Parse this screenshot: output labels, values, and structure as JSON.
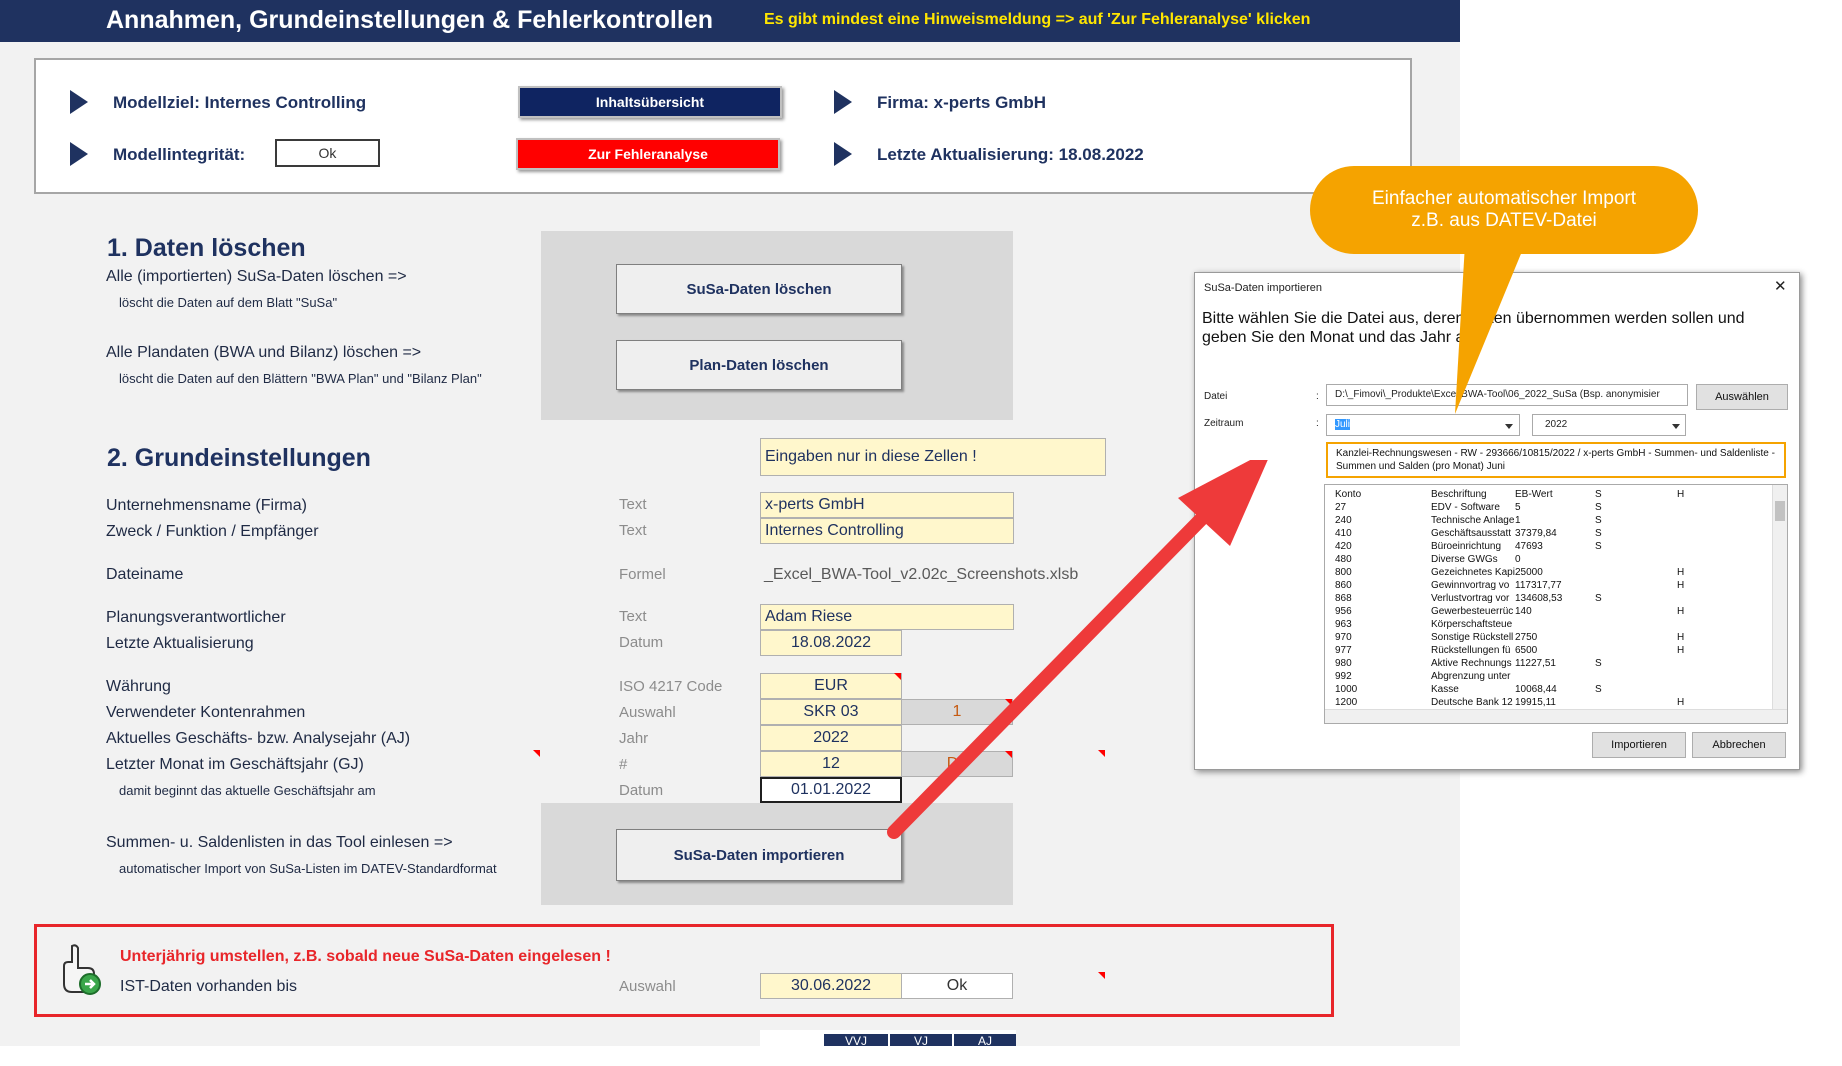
{
  "header": {
    "title": "Annahmen, Grundeinstellungen & Fehlerkontrollen",
    "hint": "Es gibt mindest eine Hinweismeldung => auf 'Zur Fehleranalyse' klicken"
  },
  "topbox": {
    "modellziel": "Modellziel: Internes Controlling",
    "modellintegritaet": "Modellintegrität:",
    "integritaet_value": "Ok",
    "btn_inhalt": "Inhaltsübersicht",
    "btn_fehler": "Zur Fehleranalyse",
    "firma": "Firma: x-perts GmbH",
    "aktualisierung": "Letzte Aktualisierung: 18.08.2022"
  },
  "section1": {
    "heading": "1. Daten löschen",
    "row1": "Alle (importierten) SuSa-Daten löschen =>",
    "row1_sub": "löscht die Daten auf dem Blatt \"SuSa\"",
    "row2": "Alle Plandaten (BWA und Bilanz) löschen =>",
    "row2_sub": "löscht die Daten auf den Blättern \"BWA Plan\" und \"Bilanz Plan\"",
    "btn_susa": "SuSa-Daten löschen",
    "btn_plan": "Plan-Daten löschen"
  },
  "section2": {
    "heading": "2. Grundeinstellungen",
    "input_hint": "Eingaben nur in diese Zellen !",
    "rows": {
      "firma_label": "Unternehmensname (Firma)",
      "firma_type": "Text",
      "firma_value": "x-perts GmbH",
      "zweck_label": "Zweck / Funktion / Empfänger",
      "zweck_type": "Text",
      "zweck_value": "Internes Controlling",
      "datei_label": "Dateiname",
      "datei_type": "Formel",
      "datei_value": "_Excel_BWA-Tool_v2.02c_Screenshots.xlsb",
      "plan_label": "Planungsverantwortlicher",
      "plan_type": "Text",
      "plan_value": "Adam Riese",
      "akt_label": "Letzte Aktualisierung",
      "akt_type": "Datum",
      "akt_value": "18.08.2022",
      "wae_label": "Währung",
      "wae_type": "ISO 4217 Code",
      "wae_value": "EUR",
      "konto_label": "Verwendeter Kontenrahmen",
      "konto_type": "Auswahl",
      "konto_value": "SKR 03",
      "konto_idx": "1",
      "gj_label": "Aktuelles Geschäfts- bzw. Analysejahr (AJ)",
      "gj_type": "Jahr",
      "gj_value": "2022",
      "monat_label": "Letzter Monat im Geschäftsjahr (GJ)",
      "monat_type": "#",
      "monat_value": "12",
      "monat_extra": "De",
      "beginn_label": "damit beginnt das aktuelle Geschäftsjahr am",
      "beginn_type": "Datum",
      "beginn_value": "01.01.2022"
    },
    "import_label": "Summen- u. Saldenlisten in das Tool einlesen =>",
    "import_sub": "automatischer Import von SuSa-Listen im DATEV-Standardformat",
    "btn_import": "SuSa-Daten importieren"
  },
  "redbox": {
    "warning": "Unterjährig umstellen, z.B. sobald neue SuSa-Daten eingelesen !",
    "ist_label": "IST-Daten vorhanden bis",
    "ist_type": "Auswahl",
    "ist_value": "30.06.2022",
    "ist_ok": "Ok"
  },
  "bottom_tabs": [
    "VVJ",
    "VJ",
    "AJ"
  ],
  "callout": {
    "line1": "Einfacher automatischer Import",
    "line2": "z.B. aus DATEV-Datei"
  },
  "dialog": {
    "title": "SuSa-Daten importieren",
    "close": "✕",
    "instruction": "Bitte wählen Sie die Datei aus, deren Daten übernommen werden sollen und geben Sie den Monat und das Jahr an.",
    "datei_label": "Datei",
    "datei_value": "D:\\_Fimovi\\_Produkte\\Excel BWA-Tool\\06_2022_SuSa (Bsp. anonymisier",
    "btn_auswaehlen": "Auswählen",
    "zeitraum_label": "Zeitraum",
    "month": "Juli",
    "year": "2022",
    "info": "Kanzlei-Rechnungswesen - RW - 293666/10815/2022 / x-perts GmbH - Summen- und Saldenliste - Summen und Salden (pro Monat) Juni",
    "columns": [
      "Konto",
      "Beschriftung",
      "EB-Wert",
      "S",
      "H"
    ],
    "rows": [
      [
        "27",
        "EDV - Software",
        "5",
        "S",
        ""
      ],
      [
        "240",
        "Technische Anlage",
        "1",
        "S",
        ""
      ],
      [
        "410",
        "Geschäftsausstatt",
        "37379,84",
        "S",
        ""
      ],
      [
        "420",
        "Büroeinrichtung",
        "47693",
        "S",
        ""
      ],
      [
        "480",
        "Diverse GWGs",
        "0",
        "",
        ""
      ],
      [
        "800",
        "Gezeichnetes Kapi",
        "25000",
        "",
        "H"
      ],
      [
        "860",
        "Gewinnvortrag vo",
        "117317,77",
        "",
        "H"
      ],
      [
        "868",
        "Verlustvortrag vor",
        "134608,53",
        "S",
        ""
      ],
      [
        "956",
        "Gewerbesteuerrüc",
        "140",
        "",
        "H"
      ],
      [
        "963",
        "Körperschaftsteue",
        "",
        "",
        ""
      ],
      [
        "970",
        "Sonstige Rückstell",
        "2750",
        "",
        "H"
      ],
      [
        "977",
        "Rückstellungen fü",
        "6500",
        "",
        "H"
      ],
      [
        "980",
        "Aktive Rechnungs",
        "11227,51",
        "S",
        ""
      ],
      [
        "992",
        "Abgrenzung unter",
        "",
        "",
        ""
      ],
      [
        "1000",
        "Kasse",
        "10068,44",
        "S",
        ""
      ],
      [
        "1200",
        "Deutsche Bank 12",
        "19915,11",
        "",
        "H"
      ]
    ],
    "btn_import": "Importieren",
    "btn_cancel": "Abbrechen"
  },
  "colors": {
    "navy": "#1f3260",
    "hint_yellow": "#ffe600",
    "red": "#ff0000",
    "callout": "#f5a300",
    "arrow": "#ee3a3a"
  }
}
